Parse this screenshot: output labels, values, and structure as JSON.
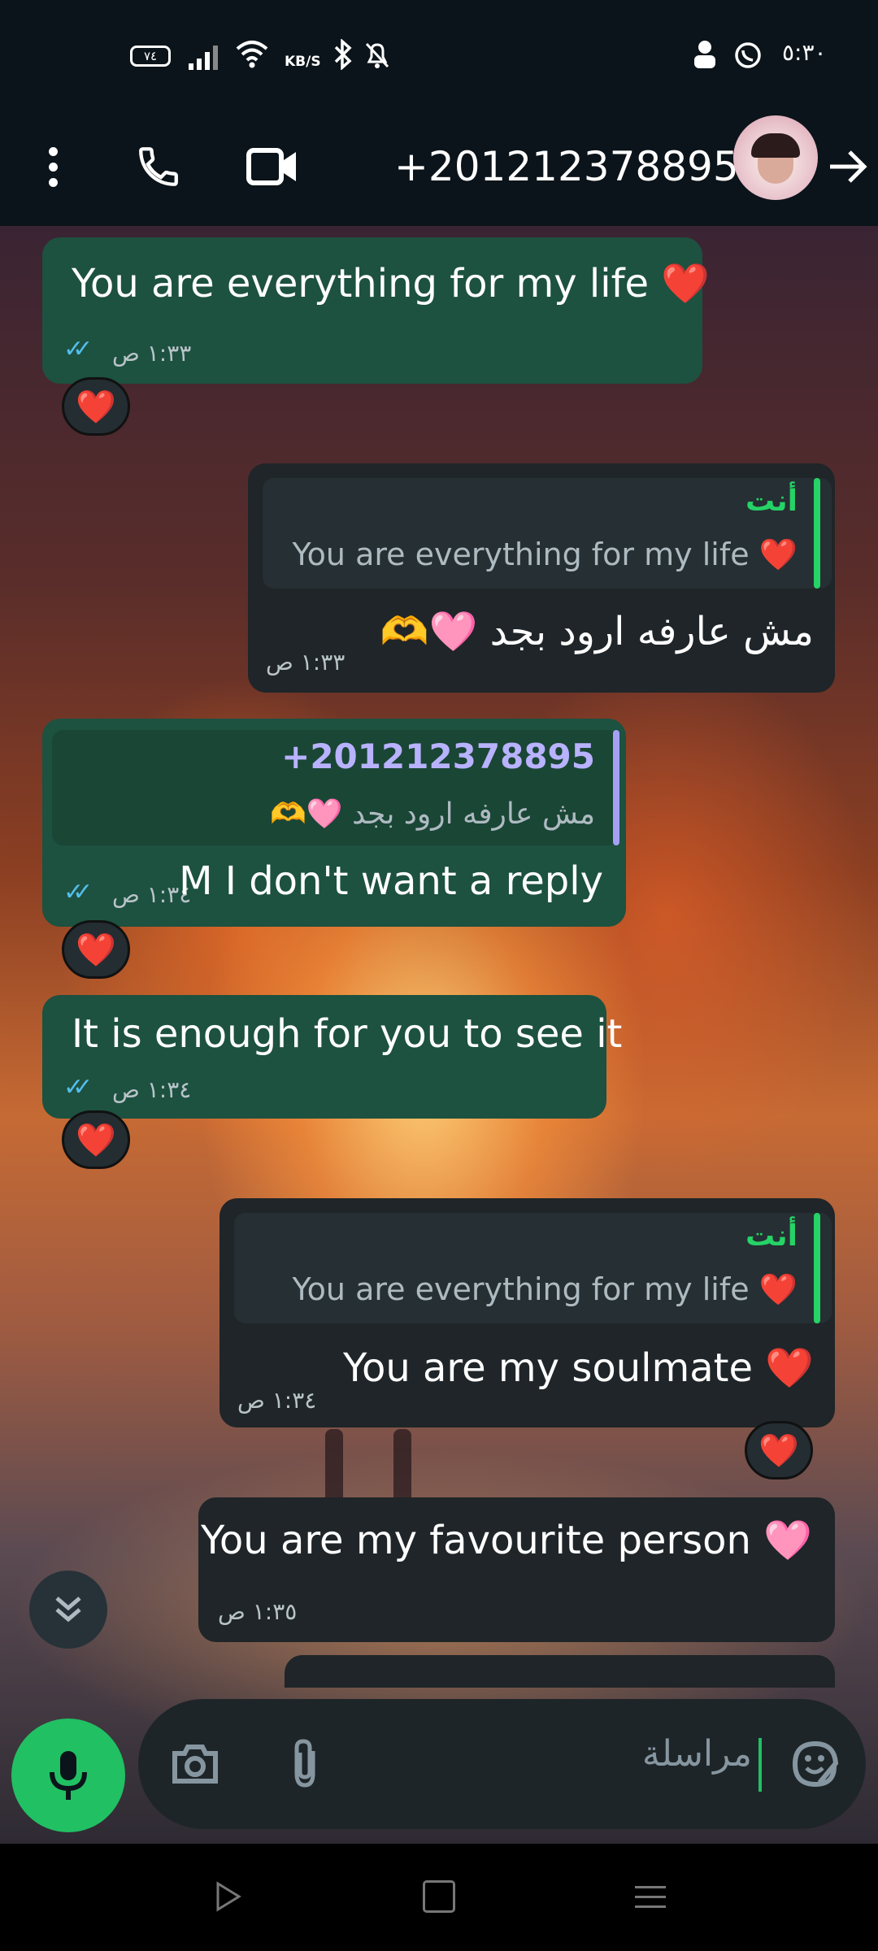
{
  "status_bar": {
    "time": "٥:٣٠",
    "battery": "٧٤",
    "net_speed": "KB/S"
  },
  "header": {
    "contact": "+201212378895",
    "icons": [
      "more-vert-icon",
      "phone-icon",
      "video-call-icon",
      "avatar",
      "arrow-forward-icon"
    ]
  },
  "messages": [
    {
      "dir": "out",
      "text": "You are everything for my life ❤️",
      "time": "١:٣٣ ص",
      "reaction": "❤️"
    },
    {
      "dir": "in",
      "quote_author": "أنت",
      "quote_text": "You are everything for my life ❤️",
      "text": "مش عارفه ارود بجد 🩷🫶",
      "time": "١:٣٣ ص"
    },
    {
      "dir": "out",
      "quote_author": "+201212378895",
      "quote_text": "مش عارفه ارود بجد 🩷🫶",
      "text": "M I don't want a reply",
      "time": "١:٣٤ ص",
      "reaction": "❤️"
    },
    {
      "dir": "out",
      "text": "It is enough for you to see it",
      "time": "١:٣٤ ص",
      "reaction": "❤️"
    },
    {
      "dir": "in",
      "quote_author": "أنت",
      "quote_text": "You are everything for my life ❤️",
      "text": "You are my soulmate ❤️",
      "time": "١:٣٤ ص",
      "reaction": "❤️"
    },
    {
      "dir": "in",
      "text": "You are my favourite person 🩷",
      "time": "١:٣٥ ص"
    }
  ],
  "composer": {
    "placeholder": "مراسلة"
  },
  "colors": {
    "outgoing": "#1d5140",
    "incoming": "#1f2528",
    "accent_green": "#21c063",
    "tick_blue": "#53bdeb",
    "quote_you": "#25d366",
    "quote_other": "#a5a0f5"
  }
}
